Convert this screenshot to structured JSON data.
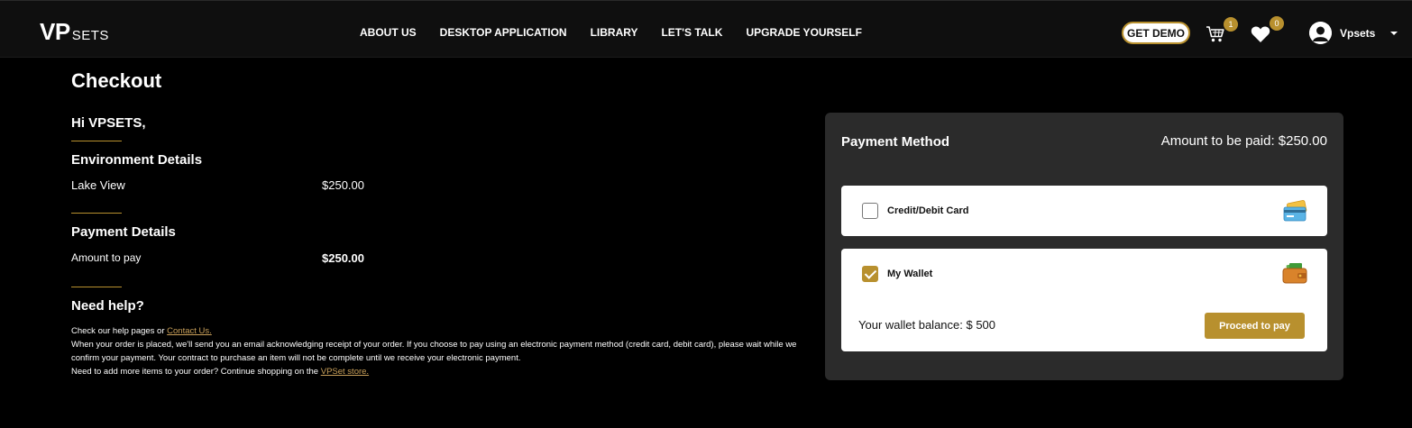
{
  "brand": {
    "logo_main": "VP",
    "logo_sub": "SETS"
  },
  "nav": {
    "items": [
      {
        "label": "ABOUT US"
      },
      {
        "label": "DESKTOP APPLICATION"
      },
      {
        "label": "LIBRARY"
      },
      {
        "label": "LET'S TALK"
      },
      {
        "label": "UPGRADE YOURSELF"
      }
    ],
    "demo_button": "GET DEMO",
    "cart_count": "1",
    "wishlist_count": "0",
    "user_name": "Vpsets"
  },
  "checkout": {
    "title": "Checkout",
    "greeting": "Hi VPSETS,",
    "environment": {
      "heading": "Environment Details",
      "item_name": "Lake View",
      "item_price": "$250.00"
    },
    "payment": {
      "heading": "Payment Details",
      "label": "Amount to pay",
      "amount": "$250.00"
    },
    "help": {
      "heading": "Need help?",
      "line1_prefix": "Check our help pages or ",
      "contact_link": "Contact Us.",
      "line2": "When your order is placed, we'll send you an email acknowledging receipt of your order. If you choose to pay using an electronic payment method (credit card, debit card), please wait while we confirm your payment. Your contract to purchase an item will not be complete until we receive your electronic payment.",
      "line3_prefix": "Need to add more items to your order? Continue shopping on the ",
      "store_link": "VPSet store."
    }
  },
  "payment_panel": {
    "title": "Payment Method",
    "amount_text": "Amount to be paid: $250.00",
    "options": [
      {
        "label": "Credit/Debit Card",
        "checked": false,
        "icon": "credit-card-icon"
      },
      {
        "label": "My Wallet",
        "checked": true,
        "icon": "wallet-icon"
      }
    ],
    "wallet_balance": "Your wallet balance: $ 500",
    "proceed_button": "Proceed to pay"
  },
  "colors": {
    "accent": "#b8902e",
    "panel": "#2b2b2b",
    "header": "#0f0f0f",
    "background": "#000000"
  }
}
